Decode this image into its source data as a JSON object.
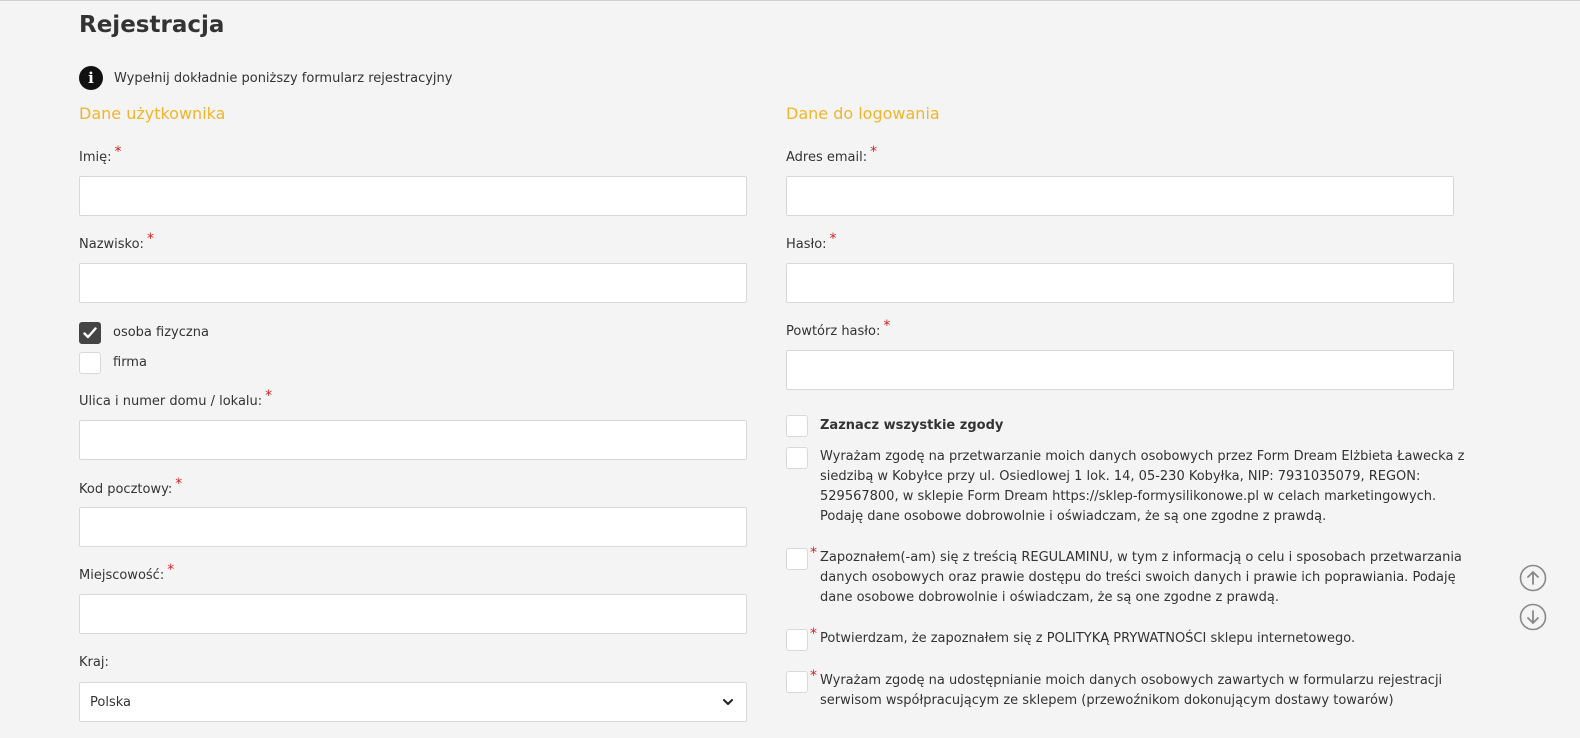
{
  "page": {
    "title": "Rejestracja",
    "info": "Wypełnij dokładnie poniższy formularz rejestracyjny"
  },
  "user_section": {
    "title": "Dane użytkownika",
    "first_name_label": "Imię:",
    "last_name_label": "Nazwisko:",
    "person_type": [
      {
        "label": "osoba fizyczna",
        "checked": true
      },
      {
        "label": "firma",
        "checked": false
      }
    ],
    "street_label": "Ulica i numer domu / lokalu:",
    "postal_label": "Kod pocztowy:",
    "city_label": "Miejscowość:",
    "country_label": "Kraj:",
    "country_value": "Polska"
  },
  "login_section": {
    "title": "Dane do logowania",
    "email_label": "Adres email:",
    "password_label": "Hasło:",
    "password_repeat_label": "Powtórz hasło:"
  },
  "consents": {
    "select_all": "Zaznacz wszystkie zgody",
    "items": [
      {
        "text": "Wyrażam zgodę na przetwarzanie moich danych osobowych przez Form Dream Elżbieta Ławecka z siedzibą w Kobyłce przy ul. Osiedlowej 1 lok. 14, 05-230 Kobyłka, NIP: 7931035079, REGON: 529567800, w sklepie Form Dream https://sklep-formysilikonowe.pl w celach marketingowych. Podaję dane osobowe dobrowolnie i oświadczam, że są one zgodne z prawdą.",
        "required": false
      },
      {
        "text": "Zapoznałem(-am) się z treścią REGULAMINU, w tym z informacją o celu i sposobach przetwarzania danych osobowych oraz prawie dostępu do treści swoich danych i prawie ich poprawiania. Podaję dane osobowe dobrowolnie i oświadczam, że są one zgodne z prawdą.",
        "required": true
      },
      {
        "text": "Potwierdzam, że zapoznałem się z POLITYKĄ PRYWATNOŚCI sklepu internetowego.",
        "required": true
      },
      {
        "text": "Wyrażam zgodę na udostępnianie moich danych osobowych zawartych w formularzu rejestracji serwisom współpracującym ze sklepem (przewoźnikom dokonującym dostawy towarów)",
        "required": true
      }
    ]
  },
  "required_mark": "*",
  "icons": {
    "info": "info-icon",
    "check": "check-icon",
    "chevron": "chevron-down-icon",
    "scroll_up": "arrow-up-circle-icon",
    "scroll_down": "arrow-down-circle-icon"
  },
  "colors": {
    "accent": "#f0b52b",
    "required": "#d21f1f"
  }
}
